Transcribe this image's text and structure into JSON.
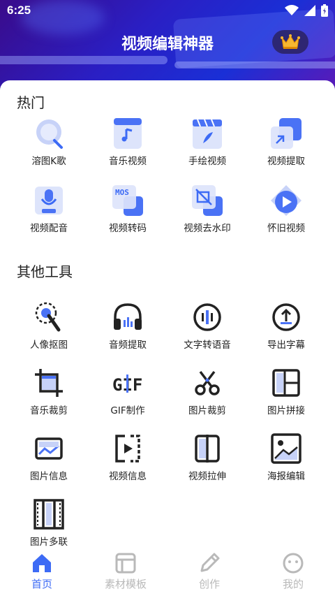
{
  "status_bar": {
    "time": "6:25"
  },
  "header": {
    "title": "视频编辑神器",
    "vip_icon": "crown-icon"
  },
  "hot": {
    "title": "热门",
    "items": [
      {
        "label": "溶图K歌",
        "icon": "mic-bubble-icon"
      },
      {
        "label": "音乐视频",
        "icon": "music-note-icon"
      },
      {
        "label": "手绘视频",
        "icon": "clapboard-feather-icon"
      },
      {
        "label": "视频提取",
        "icon": "extract-arrow-icon"
      },
      {
        "label": "视频配音",
        "icon": "microphone-icon"
      },
      {
        "label": "视频转码",
        "icon": "mos-convert-icon"
      },
      {
        "label": "视频去水印",
        "icon": "remove-watermark-icon"
      },
      {
        "label": "怀旧视频",
        "icon": "play-retro-icon"
      }
    ]
  },
  "tools": {
    "title": "其他工具",
    "items": [
      {
        "label": "人像抠图",
        "icon": "magic-wand-icon"
      },
      {
        "label": "音频提取",
        "icon": "headphones-icon"
      },
      {
        "label": "文字转语音",
        "icon": "text-to-speech-icon"
      },
      {
        "label": "导出字幕",
        "icon": "upload-circle-icon"
      },
      {
        "label": "音乐裁剪",
        "icon": "crop-icon"
      },
      {
        "label": "GIF制作",
        "icon": "gif-icon"
      },
      {
        "label": "图片裁剪",
        "icon": "scissors-icon"
      },
      {
        "label": "图片拼接",
        "icon": "collage-icon"
      },
      {
        "label": "图片信息",
        "icon": "image-info-icon"
      },
      {
        "label": "视频信息",
        "icon": "video-info-icon"
      },
      {
        "label": "视频拉伸",
        "icon": "stretch-icon"
      },
      {
        "label": "海报编辑",
        "icon": "poster-icon"
      },
      {
        "label": "图片多联",
        "icon": "film-strip-icon"
      }
    ]
  },
  "tabbar": {
    "items": [
      {
        "label": "首页",
        "icon": "home-icon",
        "active": true
      },
      {
        "label": "素材模板",
        "icon": "template-icon",
        "active": false
      },
      {
        "label": "创作",
        "icon": "pencil-icon",
        "active": false
      },
      {
        "label": "我的",
        "icon": "profile-icon",
        "active": false
      }
    ]
  },
  "colors": {
    "accent": "#3d6bf5",
    "header_start": "#3a0b8a",
    "header_end": "#1a2fd6",
    "inactive": "#b9b9b9"
  }
}
